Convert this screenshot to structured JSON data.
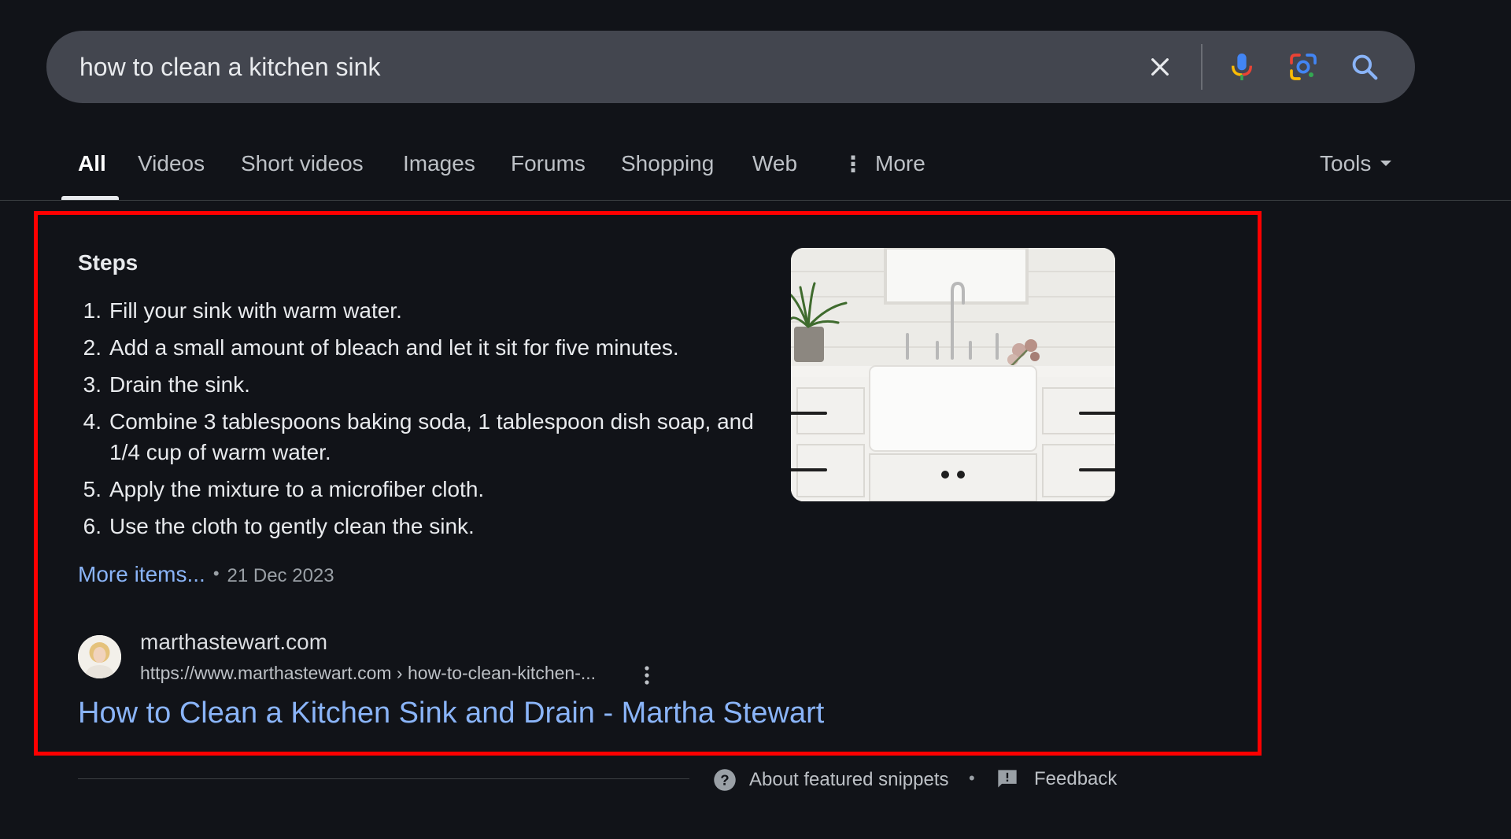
{
  "search": {
    "query": "how to clean a kitchen sink"
  },
  "tabs": [
    {
      "label": "All",
      "active": true
    },
    {
      "label": "Videos"
    },
    {
      "label": "Short videos"
    },
    {
      "label": "Images"
    },
    {
      "label": "Forums"
    },
    {
      "label": "Shopping"
    },
    {
      "label": "Web"
    },
    {
      "label": "More"
    }
  ],
  "tools_label": "Tools",
  "snippet": {
    "title": "Steps",
    "steps": [
      {
        "num": "1.",
        "text": "Fill your sink with warm water."
      },
      {
        "num": "2.",
        "text": "Add a small amount of bleach and let it sit for five minutes."
      },
      {
        "num": "3.",
        "text": "Drain the sink."
      },
      {
        "num": "4.",
        "text": "Combine 3 tablespoons baking soda, 1 tablespoon dish soap, and 1/4 cup of warm water."
      },
      {
        "num": "5.",
        "text": "Apply the mixture to a microfiber cloth."
      },
      {
        "num": "6.",
        "text": "Use the cloth to gently clean the sink."
      }
    ],
    "more_items": "More items...",
    "date": "21 Dec 2023",
    "source_name": "marthastewart.com",
    "source_url": "https://www.marthastewart.com › how-to-clean-kitchen-...",
    "result_title": "How to Clean a Kitchen Sink and Drain - Martha Stewart"
  },
  "footer": {
    "about": "About featured snippets",
    "feedback": "Feedback"
  },
  "colors": {
    "background": "#111318",
    "search_bar": "#43464f",
    "link": "#8ab4f8",
    "highlight": "#ff0000"
  }
}
